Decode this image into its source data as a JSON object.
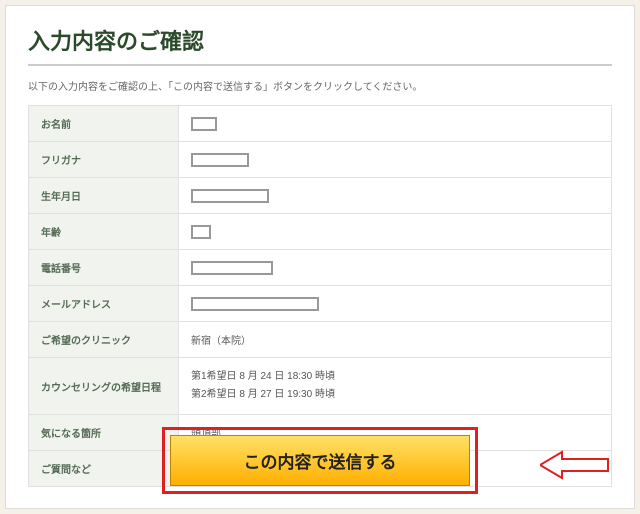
{
  "title": "入力内容のご確認",
  "subtitle": "以下の入力内容をご確認の上、「この内容で送信する」ボタンをクリックしてください。",
  "fields": {
    "name_label": "お名前",
    "furigana_label": "フリガナ",
    "birthdate_label": "生年月日",
    "age_label": "年齢",
    "phone_label": "電話番号",
    "email_label": "メールアドレス",
    "clinic_label": "ご希望のクリニック",
    "clinic_value": "新宿（本院）",
    "schedule_label": "カウンセリングの希望日程",
    "schedule_line1": "第1希望日 8 月 24 日 18:30 時頃",
    "schedule_line2": "第2希望日 8 月 27 日 19:30 時頃",
    "concern_label": "気になる箇所",
    "concern_value": "頭頂部",
    "questions_label": "ご質問など"
  },
  "submit_label": "この内容で送信する"
}
